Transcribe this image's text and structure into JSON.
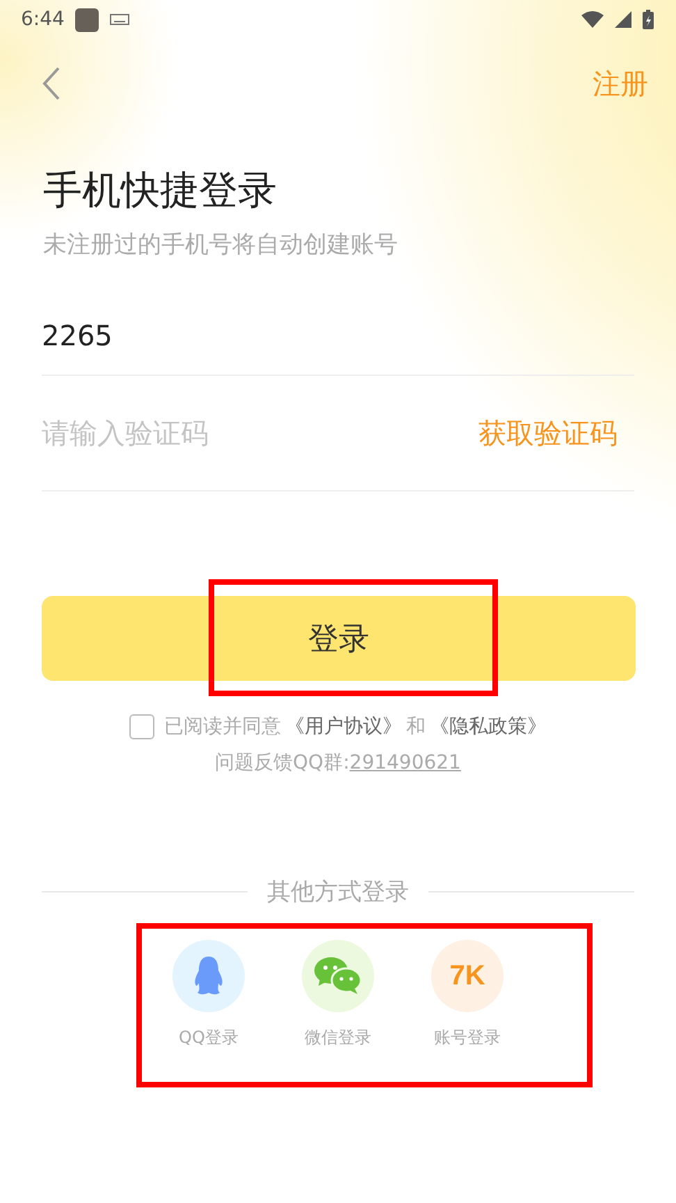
{
  "status_bar": {
    "time": "6:44"
  },
  "header": {
    "register": "注册"
  },
  "title": "手机快捷登录",
  "subtitle": "未注册过的手机号将自动创建账号",
  "phone_field": {
    "value": "2265"
  },
  "code_field": {
    "placeholder": "请输入验证码",
    "get_code": "获取验证码"
  },
  "login_button": {
    "label": "登录",
    "highlighted": true
  },
  "agreement": {
    "checked": false,
    "prefix": "已阅读并同意",
    "terms": "《用户协议》",
    "and": "和",
    "privacy": "《隐私政策》"
  },
  "feedback": {
    "label": "问题反馈QQ群:",
    "group": "291490621"
  },
  "other_logins": {
    "title": "其他方式登录",
    "highlighted": true,
    "items": [
      {
        "kind": "qq",
        "label": "QQ登录"
      },
      {
        "kind": "wechat",
        "label": "微信登录"
      },
      {
        "kind": "account",
        "badge": "7K",
        "label": "账号登录"
      }
    ]
  }
}
